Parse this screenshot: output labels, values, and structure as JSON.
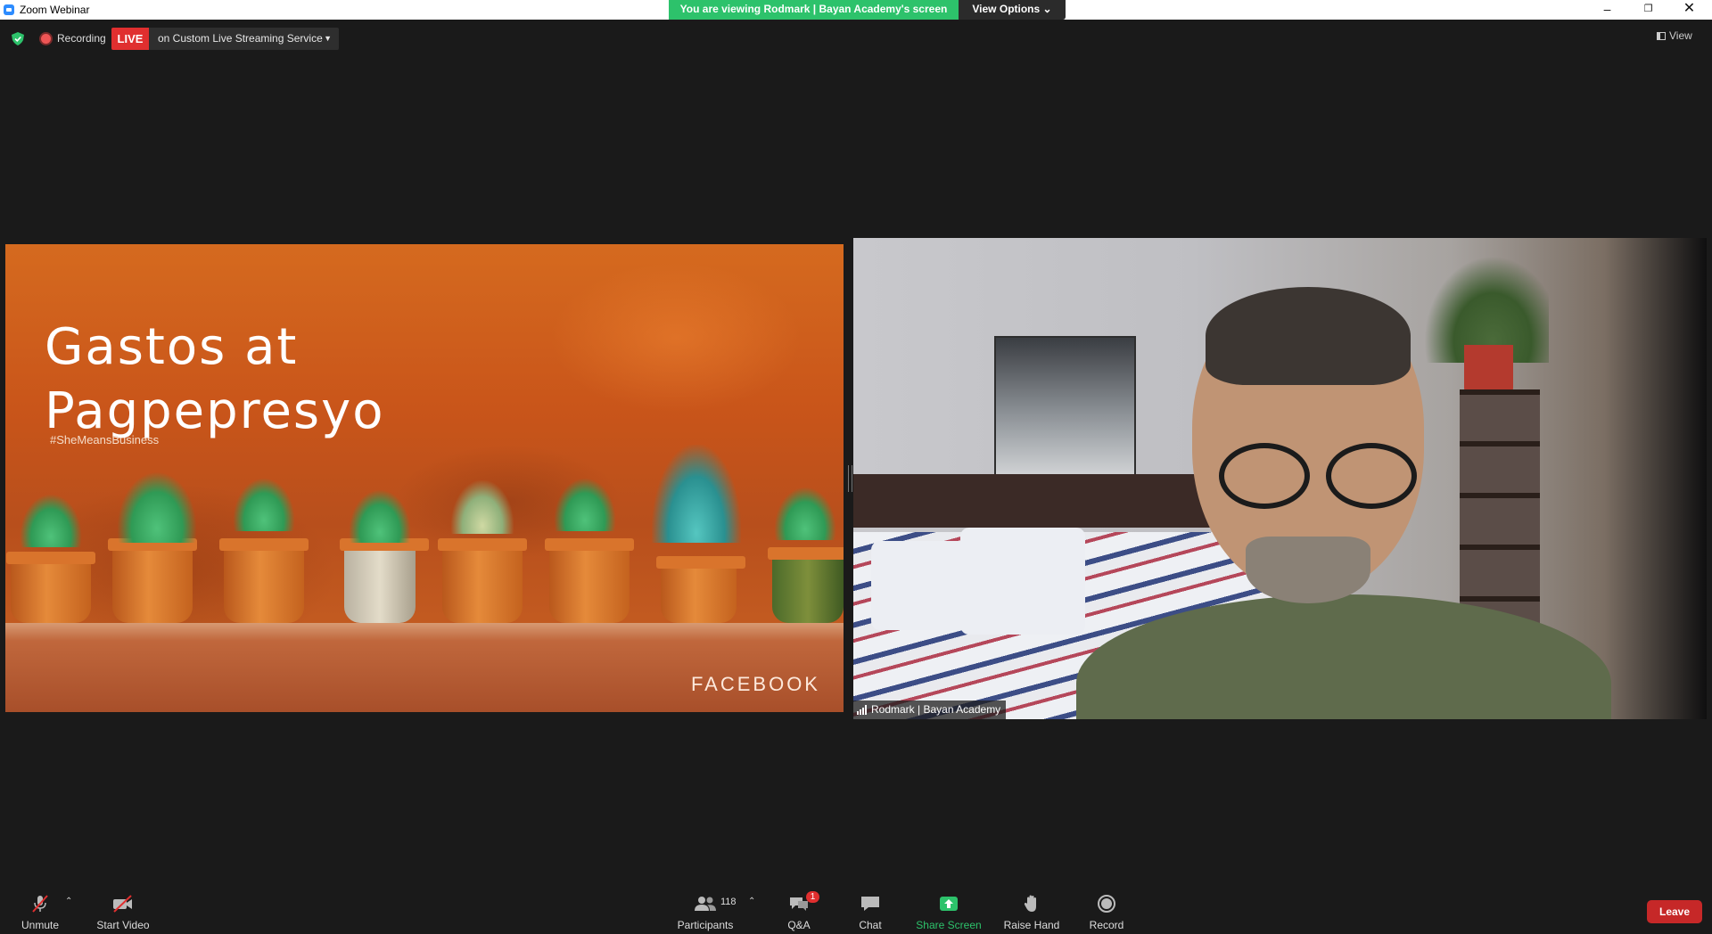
{
  "window": {
    "title": "Zoom Webinar"
  },
  "banner": {
    "viewing_text": "You are viewing Rodmark | Bayan Academy's screen",
    "view_options_label": "View Options",
    "color": "#2dc26b"
  },
  "status": {
    "recording_label": "Recording",
    "live_label": "LIVE",
    "live_service": "on Custom Live Streaming Service",
    "view_label": "View"
  },
  "shared_screen": {
    "slide_title_line1": "Gastos at",
    "slide_title_line2": "Pagpepresyo",
    "hashtag": "#SheMeansBusiness",
    "brand": "FACEBOOK"
  },
  "video": {
    "participant_name": "Rodmark | Bayan Academy"
  },
  "toolbar": {
    "unmute_label": "Unmute",
    "start_video_label": "Start Video",
    "participants_label": "Participants",
    "participants_count": "118",
    "qa_label": "Q&A",
    "qa_badge": "1",
    "chat_label": "Chat",
    "share_screen_label": "Share Screen",
    "raise_hand_label": "Raise Hand",
    "record_label": "Record",
    "leave_label": "Leave",
    "leave_color": "#c62828"
  }
}
